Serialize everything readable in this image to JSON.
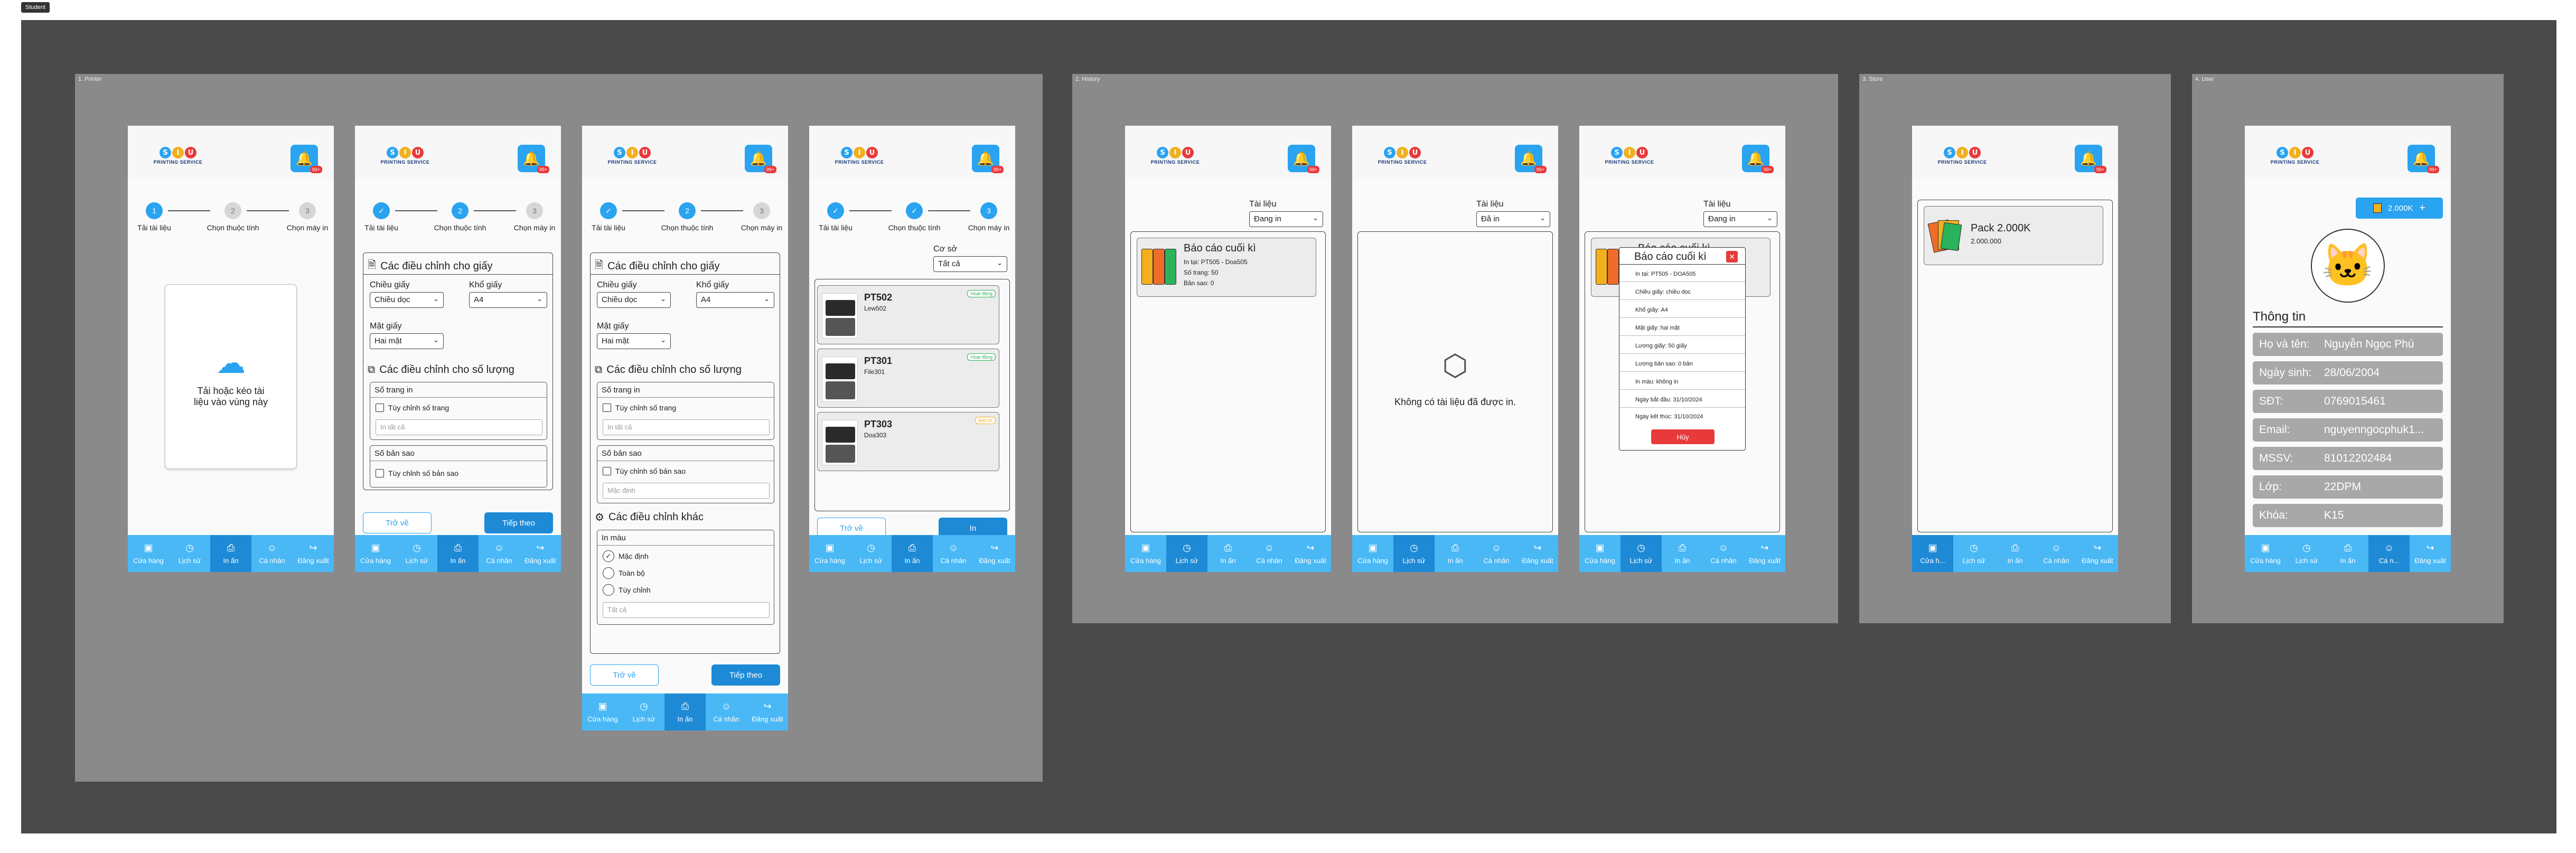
{
  "frame_tag": "Student",
  "sections": {
    "print": "1. Printer",
    "history": "2. History",
    "store": "3. Store",
    "user": "4. User"
  },
  "logo": {
    "letters": [
      "S",
      "I",
      "U"
    ],
    "brand": "PRINTING SERVICE",
    "colors": [
      "#2aa3f0",
      "#f2b01e",
      "#e83a3a"
    ]
  },
  "bell_badge": "99+",
  "nav": [
    "Cửa hàng",
    "Lịch sử",
    "In ấn",
    "Cá nhân",
    "Đăng xuất"
  ],
  "nav_store_short": "Cửa h...",
  "nav_user_short": "Cá n...",
  "steps": [
    "Tải tài liệu",
    "Chọn thuộc tính",
    "Chọn máy in"
  ],
  "step_numbers": [
    "1",
    "2",
    "3"
  ],
  "upload_text": "Tải hoặc kéo tài liệu vào vùng này",
  "paper": {
    "title": "Các điều chỉnh cho giấy",
    "orientation_label": "Chiều giấy",
    "orientation_value": "Chiều dọc",
    "size_label": "Khổ giấy",
    "size_value": "A4",
    "side_label": "Mặt giấy",
    "side_value": "Hai mặt"
  },
  "quantity": {
    "title": "Các điều chỉnh cho số lượng",
    "pages_label": "Số trang in",
    "pages_check": "Tùy chỉnh số trang",
    "pages_placeholder": "In tất cả",
    "copies_label": "Số bản sao",
    "copies_check": "Tùy chỉnh số bản sao",
    "copies_placeholder": "Mặc định"
  },
  "other": {
    "title": "Các điều chỉnh khác",
    "color_label": "In màu",
    "opt_default": "Mặc định",
    "opt_full": "Toàn bộ",
    "opt_custom": "Tùy chỉnh",
    "placeholder": "Tất cả"
  },
  "buttons": {
    "back": "Trở về",
    "next": "Tiếp theo",
    "print": "In",
    "cancel": "Hủy"
  },
  "printers": {
    "facility_label": "Cơ sở",
    "facility_value": "Tất cả",
    "items": [
      {
        "name": "PT502",
        "location": "Lew502",
        "status": "Hoạt động",
        "status_color": "#2ab35a"
      },
      {
        "name": "PT301",
        "location": "File301",
        "status": "Hoạt động",
        "status_color": "#2ab35a"
      },
      {
        "name": "PT303",
        "location": "Doa303",
        "status": "Bảo trì",
        "status_color": "#f2b01e"
      }
    ]
  },
  "history": {
    "filter_label": "Tài liệu",
    "filter_printing": "Đang in",
    "filter_printed": "Đã in",
    "empty": "Không có tài liệu đã được in.",
    "doc_name": "Báo cáo cuối kì",
    "doc_lines": [
      "In tại: PT505 - Doa505",
      "Số trang: 50",
      "Bản sao: 0"
    ],
    "modal_title": "Báo cáo cuối kì",
    "modal_lines": [
      "In tại: PT505 - DOA505",
      "Chiều giấy: chiều dọc",
      "Khổ giấy: A4",
      "Mặt giấy: hai mặt",
      "Lượng giấy: 50 giấy",
      "Lượng bản sao: 0 bản",
      "In màu: không in",
      "Ngày bắt đầu: 31/10/2024",
      "Ngày kết thúc: 31/10/2024"
    ]
  },
  "store": {
    "pack_name": "Pack 2.000K",
    "pack_price": "2.000.000"
  },
  "user": {
    "balance": "2.000K",
    "plus": "+",
    "info_title": "Thông tin",
    "rows": [
      {
        "k": "Họ và tên:",
        "v": "Nguyễn Ngọc Phú"
      },
      {
        "k": "Ngày sinh:",
        "v": "28/06/2004"
      },
      {
        "k": "SĐT:",
        "v": "0769015461"
      },
      {
        "k": "Email:",
        "v": "nguyenngocphuk1..."
      },
      {
        "k": "MSSV:",
        "v": "81012202484"
      },
      {
        "k": "Lớp:",
        "v": "22DPM"
      },
      {
        "k": "Khóa:",
        "v": "K15"
      }
    ]
  }
}
